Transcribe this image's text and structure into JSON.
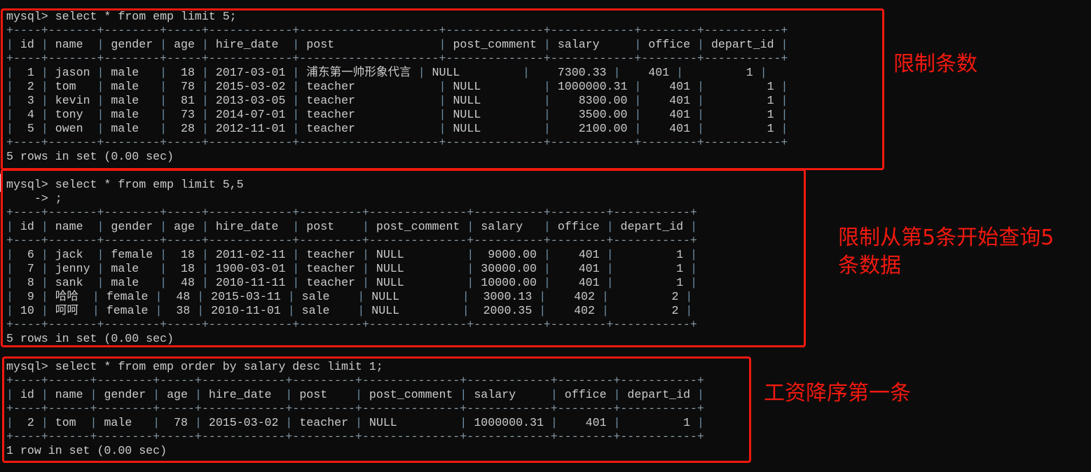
{
  "terminal": {
    "prompt": "mysql>",
    "continuation_prompt": "    ->",
    "queries": [
      {
        "command_lines": [
          "select * from emp limit 5;"
        ],
        "columns": [
          "id",
          "name",
          "gender",
          "age",
          "hire_date",
          "post",
          "post_comment",
          "salary",
          "office",
          "depart_id"
        ],
        "rows": [
          [
            "1",
            "jason",
            "male",
            "18",
            "2017-03-01",
            "浦东第一帅形象代言",
            "NULL",
            "7300.33",
            "401",
            "1"
          ],
          [
            "2",
            "tom",
            "male",
            "78",
            "2015-03-02",
            "teacher",
            "NULL",
            "1000000.31",
            "401",
            "1"
          ],
          [
            "3",
            "kevin",
            "male",
            "81",
            "2013-03-05",
            "teacher",
            "NULL",
            "8300.00",
            "401",
            "1"
          ],
          [
            "4",
            "tony",
            "male",
            "73",
            "2014-07-01",
            "teacher",
            "NULL",
            "3500.00",
            "401",
            "1"
          ],
          [
            "5",
            "owen",
            "male",
            "28",
            "2012-11-01",
            "teacher",
            "NULL",
            "2100.00",
            "401",
            "1"
          ]
        ],
        "status": "5 rows in set (0.00 sec)"
      },
      {
        "command_lines": [
          "select * from emp limit 5,5",
          ";"
        ],
        "columns": [
          "id",
          "name",
          "gender",
          "age",
          "hire_date",
          "post",
          "post_comment",
          "salary",
          "office",
          "depart_id"
        ],
        "rows": [
          [
            "6",
            "jack",
            "female",
            "18",
            "2011-02-11",
            "teacher",
            "NULL",
            "9000.00",
            "401",
            "1"
          ],
          [
            "7",
            "jenny",
            "male",
            "18",
            "1900-03-01",
            "teacher",
            "NULL",
            "30000.00",
            "401",
            "1"
          ],
          [
            "8",
            "sank",
            "male",
            "48",
            "2010-11-11",
            "teacher",
            "NULL",
            "10000.00",
            "401",
            "1"
          ],
          [
            "9",
            "哈哈",
            "female",
            "48",
            "2015-03-11",
            "sale",
            "NULL",
            "3000.13",
            "402",
            "2"
          ],
          [
            "10",
            "呵呵",
            "female",
            "38",
            "2010-11-01",
            "sale",
            "NULL",
            "2000.35",
            "402",
            "2"
          ]
        ],
        "status": "5 rows in set (0.00 sec)"
      },
      {
        "command_lines": [
          "select * from emp order by salary desc limit 1;"
        ],
        "columns": [
          "id",
          "name",
          "gender",
          "age",
          "hire_date",
          "post",
          "post_comment",
          "salary",
          "office",
          "depart_id"
        ],
        "rows": [
          [
            "2",
            "tom",
            "male",
            "78",
            "2015-03-02",
            "teacher",
            "NULL",
            "1000000.31",
            "401",
            "1"
          ]
        ],
        "status": "1 row in set (0.00 sec)"
      }
    ]
  },
  "annotations": [
    {
      "label": "限制条数"
    },
    {
      "label": "限制从第5条开始查询5\n条数据"
    },
    {
      "label": "工资降序第一条"
    }
  ],
  "colors": {
    "background": "#0c0c0c",
    "text": "#cccccc",
    "annotation": "#f2190f"
  }
}
